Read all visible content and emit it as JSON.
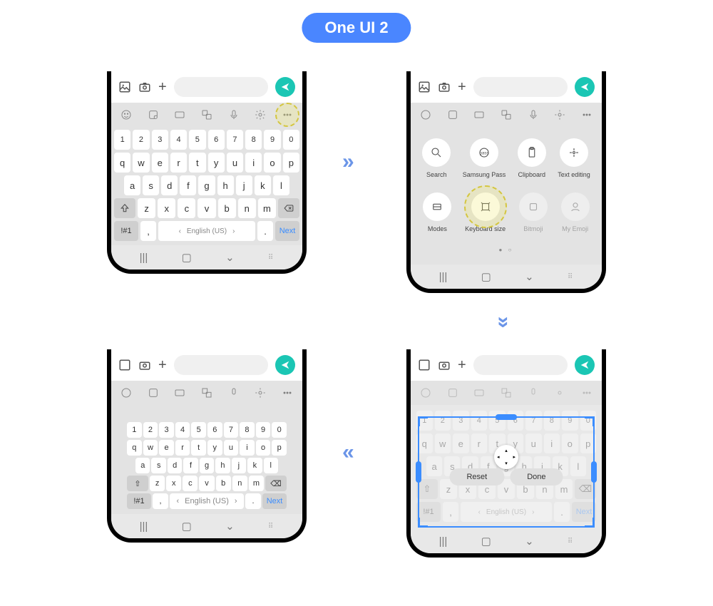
{
  "title": "One UI 2",
  "msgbar": {
    "send": "send"
  },
  "keys": {
    "nums": [
      "1",
      "2",
      "3",
      "4",
      "5",
      "6",
      "7",
      "8",
      "9",
      "0"
    ],
    "r1": [
      "q",
      "w",
      "e",
      "r",
      "t",
      "y",
      "u",
      "i",
      "o",
      "p"
    ],
    "r2": [
      "a",
      "s",
      "d",
      "f",
      "g",
      "h",
      "j",
      "k",
      "l"
    ],
    "r3": [
      "z",
      "x",
      "c",
      "v",
      "b",
      "n",
      "m"
    ],
    "sym": "!#1",
    "comma": ",",
    "period": ".",
    "space_lang": "English (US)",
    "next": "Next"
  },
  "panel": {
    "items": [
      {
        "label": "Search"
      },
      {
        "label": "Samsung Pass"
      },
      {
        "label": "Clipboard"
      },
      {
        "label": "Text editing"
      },
      {
        "label": "Modes"
      },
      {
        "label": "Keyboard size"
      },
      {
        "label": "Bitmoji"
      },
      {
        "label": "My Emoji"
      }
    ],
    "dots": "● ○"
  },
  "resize": {
    "reset": "Reset",
    "done": "Done"
  }
}
